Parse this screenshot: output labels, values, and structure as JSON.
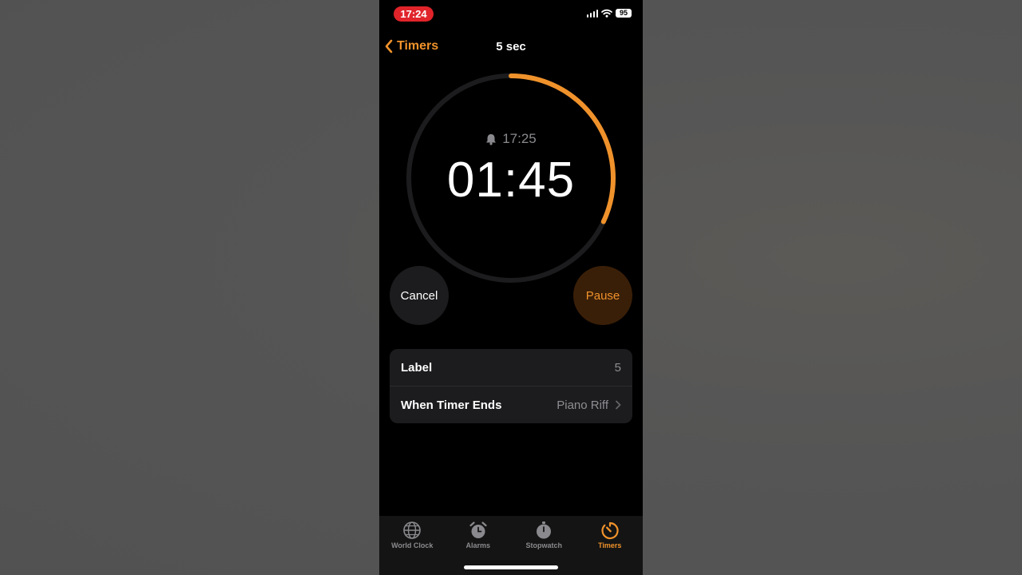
{
  "status_bar": {
    "time": "17:24",
    "battery": "95"
  },
  "nav": {
    "back_label": "Timers",
    "title": "5 sec"
  },
  "timer": {
    "alarm_time": "17:25",
    "remaining": "01:45",
    "progress_remaining": 0.32
  },
  "controls": {
    "cancel_label": "Cancel",
    "pause_label": "Pause"
  },
  "settings": {
    "label_title": "Label",
    "label_value": "5",
    "sound_title": "When Timer Ends",
    "sound_value": "Piano Riff"
  },
  "tabs": [
    {
      "label": "World Clock",
      "icon": "globe-icon"
    },
    {
      "label": "Alarms",
      "icon": "alarm-clock-icon"
    },
    {
      "label": "Stopwatch",
      "icon": "stopwatch-icon"
    },
    {
      "label": "Timers",
      "icon": "timer-icon",
      "active": true
    }
  ],
  "colors": {
    "accent": "#f0922b",
    "ring_track": "#1c1c1e",
    "recording_pill": "#e0242a"
  }
}
